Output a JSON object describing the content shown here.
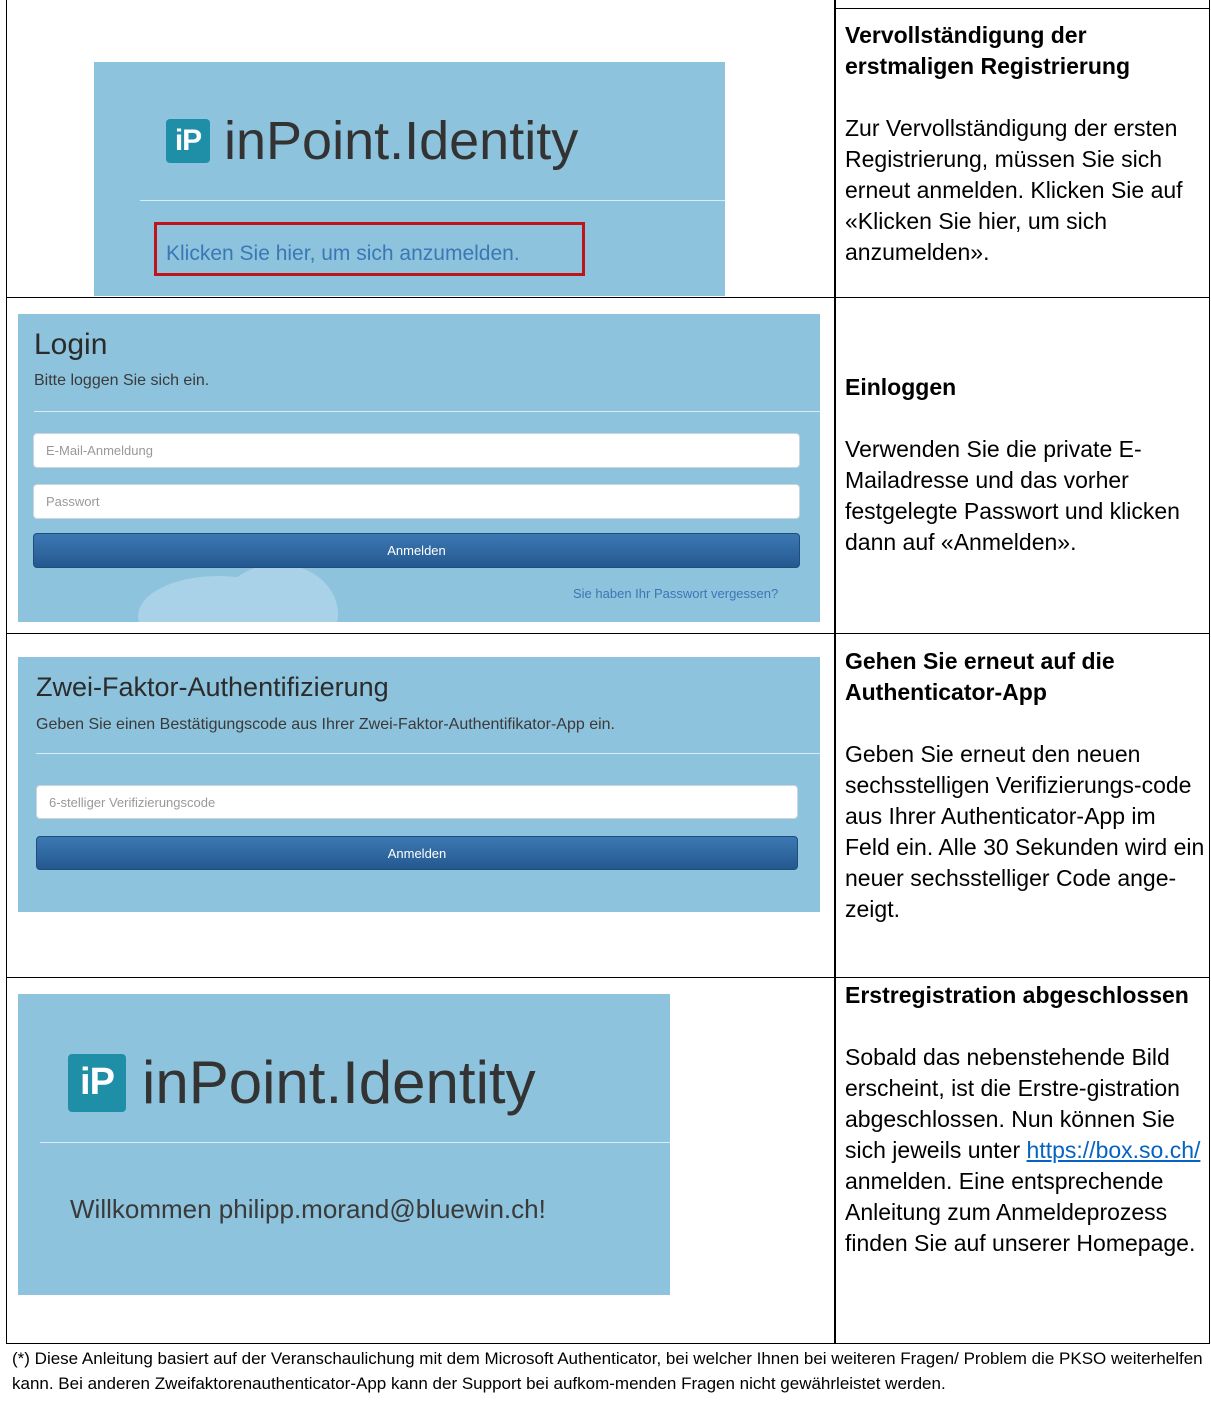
{
  "rows": [
    {
      "title": "Vervollständigung der erstmaligen Registrierung",
      "body": "Zur Vervollständigung der ersten Registrierung, müssen Sie sich erneut anmelden. Klicken Sie auf «Klicken Sie hier, um sich anzumelden»."
    },
    {
      "title": "Einloggen",
      "body": "Verwenden Sie die private E-Mailadresse und das vorher festgelegte Passwort und klicken dann auf «Anmelden»."
    },
    {
      "title": "Gehen Sie erneut auf die Authenticator-App",
      "body": "Geben Sie erneut den neuen sechsstelligen Verifizierungs-code aus Ihrer Authenticator-App im Feld ein. Alle 30 Sekunden wird ein neuer sechsstelliger Code ange-zeigt."
    },
    {
      "title": "Erstregistration abgeschlossen",
      "body_before": "Sobald das nebenstehende Bild erscheint, ist die Erstre-gistration abgeschlossen. Nun können Sie sich jeweils unter",
      "link": "https://box.so.ch/",
      "body_after": "anmelden. Eine entsprechende Anleitung zum Anmeldeprozess finden Sie auf unserer Homepage."
    }
  ],
  "panels": {
    "logo_badge": "iP",
    "logo_text": "inPoint.Identity",
    "signin_link": "Klicken Sie hier, um sich anzumelden.",
    "login": {
      "title": "Login",
      "subtitle": "Bitte loggen Sie sich ein.",
      "email_placeholder": "E-Mail-Anmeldung",
      "password_placeholder": "Passwort",
      "button": "Anmelden",
      "forgot": "Sie haben Ihr Passwort vergessen?"
    },
    "twofa": {
      "title": "Zwei-Faktor-Authentifizierung",
      "subtitle": "Geben Sie einen Bestätigungscode aus Ihrer Zwei-Faktor-Authentifikator-App ein.",
      "code_placeholder": "6-stelliger Verifizierungscode",
      "button": "Anmelden"
    },
    "welcome": "Willkommen philipp.morand@bluewin.ch!"
  },
  "footer": "(*) Diese Anleitung basiert auf der Veranschaulichung mit dem Microsoft Authenticator, bei welcher Ihnen bei weiteren Fragen/ Problem die PKSO weiterhelfen kann. Bei anderen Zweifaktorenauthenticator-App kann der Support bei aufkom-menden Fragen nicht gewährleistet werden.",
  "colors": {
    "panel_bg": "#8ec3dd",
    "badge": "#1f8fa8",
    "button": "#2c649e",
    "link": "#0563c1",
    "highlight_border": "#c0141b"
  }
}
